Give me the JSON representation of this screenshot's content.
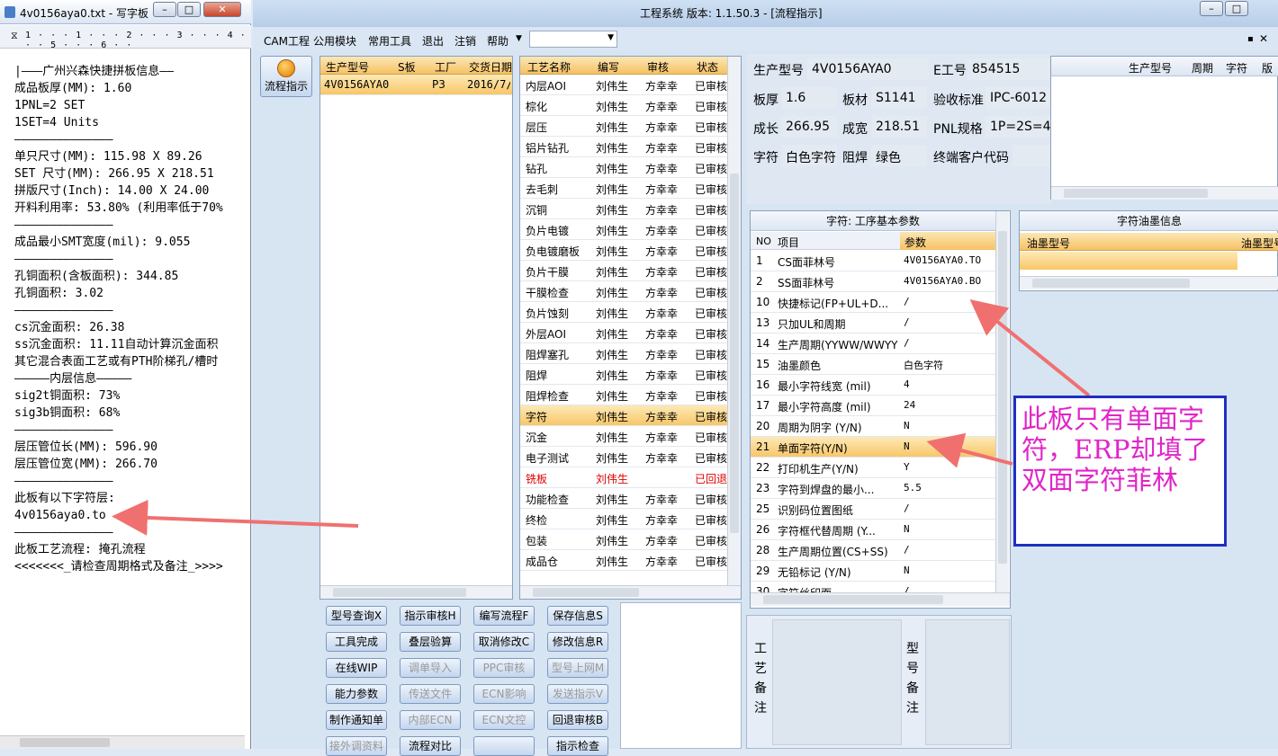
{
  "notepad": {
    "title": "4v0156aya0.txt - 写字板",
    "ruler": "1 · · · 1 · · · 2 · · · 3 · · · 4 · · · 5 · · · 6 · ·",
    "lines": [
      "|———广州兴森快捷拼板信息——",
      "成品板厚(MM): 1.60",
      "1PNL=2 SET",
      "1SET=4 Units",
      "——————————————",
      "单只尺寸(MM): 115.98 X 89.26",
      "SET 尺寸(MM): 266.95 X 218.51",
      "拼版尺寸(Inch): 14.00 X 24.00",
      "开料利用率: 53.80% (利用率低于70%",
      "——————————————",
      "成品最小SMT宽度(mil): 9.055",
      "——————————————",
      "孔铜面积(含板面积): 344.85",
      "孔铜面积: 3.02",
      "——————————————",
      "cs沉金面积: 26.38",
      "ss沉金面积: 11.11自动计算沉金面积",
      "其它混合表面工艺或有PTH阶梯孔/槽时",
      "—————内层信息—————",
      "sig2t铜面积: 73%",
      "sig3b铜面积: 68%",
      "——————————————",
      "层压管位长(MM): 596.90",
      "层压管位宽(MM): 266.70",
      "——————————————",
      "此板有以下字符层:",
      "4v0156aya0.to",
      "——————————————",
      "此板工艺流程: 掩孔流程",
      "<<<<<<<_请检查周期格式及备注_>>>>"
    ]
  },
  "main": {
    "title": "工程系统   版本: 1.1.50.3 - [流程指示]",
    "menu": [
      "CAM工程",
      "公用模块",
      "常用工具",
      "退出",
      "注销",
      "帮助"
    ],
    "side_button": "流程指示",
    "orders": {
      "headers": [
        "生产型号",
        "S板",
        "工厂",
        "交货日期"
      ],
      "rows": [
        [
          "4V0156AYA0",
          "",
          "P3",
          "2016/7/"
        ]
      ]
    },
    "process": {
      "headers": [
        "工艺名称",
        "编写",
        "审核",
        "状态"
      ],
      "rows": [
        [
          "内层AOI",
          "刘伟生",
          "方幸幸",
          "已审核"
        ],
        [
          "棕化",
          "刘伟生",
          "方幸幸",
          "已审核"
        ],
        [
          "层压",
          "刘伟生",
          "方幸幸",
          "已审核"
        ],
        [
          "铝片钻孔",
          "刘伟生",
          "方幸幸",
          "已审核"
        ],
        [
          "钻孔",
          "刘伟生",
          "方幸幸",
          "已审核"
        ],
        [
          "去毛刺",
          "刘伟生",
          "方幸幸",
          "已审核"
        ],
        [
          "沉铜",
          "刘伟生",
          "方幸幸",
          "已审核"
        ],
        [
          "负片电镀",
          "刘伟生",
          "方幸幸",
          "已审核"
        ],
        [
          "负电镀磨板",
          "刘伟生",
          "方幸幸",
          "已审核"
        ],
        [
          "负片干膜",
          "刘伟生",
          "方幸幸",
          "已审核"
        ],
        [
          "干膜检查",
          "刘伟生",
          "方幸幸",
          "已审核"
        ],
        [
          "负片蚀刻",
          "刘伟生",
          "方幸幸",
          "已审核"
        ],
        [
          "外层AOI",
          "刘伟生",
          "方幸幸",
          "已审核"
        ],
        [
          "阻焊塞孔",
          "刘伟生",
          "方幸幸",
          "已审核"
        ],
        [
          "阻焊",
          "刘伟生",
          "方幸幸",
          "已审核"
        ],
        [
          "阻焊检查",
          "刘伟生",
          "方幸幸",
          "已审核"
        ],
        [
          "字符",
          "刘伟生",
          "方幸幸",
          "已审核"
        ],
        [
          "沉金",
          "刘伟生",
          "方幸幸",
          "已审核"
        ],
        [
          "电子测试",
          "刘伟生",
          "方幸幸",
          "已审核"
        ],
        [
          "铣板",
          "刘伟生",
          "",
          "已回退"
        ],
        [
          "功能检查",
          "刘伟生",
          "方幸幸",
          "已审核"
        ],
        [
          "终检",
          "刘伟生",
          "方幸幸",
          "已审核"
        ],
        [
          "包装",
          "刘伟生",
          "方幸幸",
          "已审核"
        ],
        [
          "成品仓",
          "刘伟生",
          "方幸幸",
          "已审核"
        ]
      ]
    },
    "info": {
      "model_label": "生产型号",
      "model": "4V0156AYA0",
      "e_label": "E工号",
      "e_no": "854515",
      "thick_label": "板厚",
      "thick": "1.6",
      "mat_label": "板材",
      "mat": "S1141",
      "std_label": "验收标准",
      "std": "IPC-6012",
      "len_label": "成长",
      "len": "266.95",
      "wid_label": "成宽",
      "wid": "218.51",
      "pnl_label": "PNL规格",
      "pnl": "1P=2S=4U",
      "char_label": "字符",
      "char": "白色字符",
      "mask_label": "阻焊",
      "mask": "绿色",
      "cust_label": "终端客户代码",
      "cust": ""
    },
    "right_mini_headers": [
      "生产型号",
      "周期",
      "字符",
      "版"
    ],
    "params": {
      "title": "字符: 工序基本参数",
      "headers": [
        "NO",
        "项目",
        "参数"
      ],
      "rows": [
        [
          "1",
          "CS面菲林号",
          "4V0156AYA0.TO"
        ],
        [
          "2",
          "SS面菲林号",
          "4V0156AYA0.BO"
        ],
        [
          "10",
          "快捷标记(FP+UL+D...",
          "/"
        ],
        [
          "13",
          "只加UL和周期",
          "/"
        ],
        [
          "14",
          "生产周期(YYWW/WWYY)",
          "/"
        ],
        [
          "15",
          "油墨颜色",
          "白色字符"
        ],
        [
          "16",
          "最小字符线宽 (mil)",
          "4"
        ],
        [
          "17",
          "最小字符高度 (mil)",
          "24"
        ],
        [
          "20",
          "周期为阴字 (Y/N)",
          "N"
        ],
        [
          "21",
          "单面字符(Y/N)",
          "N"
        ],
        [
          "22",
          "打印机生产(Y/N)",
          "Y"
        ],
        [
          "23",
          "字符到焊盘的最小...",
          "5.5"
        ],
        [
          "25",
          "识别码位置图纸",
          "/"
        ],
        [
          "26",
          "字符框代替周期 (Y...",
          "N"
        ],
        [
          "28",
          "生产周期位置(CS+SS)",
          "/"
        ],
        [
          "29",
          "无铅标记 (Y/N)",
          "N"
        ],
        [
          "30",
          "字符丝印面",
          "/"
        ]
      ]
    },
    "ink": {
      "title": "字符油墨信息",
      "headers": [
        "油墨型号",
        "油墨型号"
      ]
    },
    "remark1": "工艺备注",
    "remark2": "型号备注",
    "buttons": [
      [
        "型号查询X",
        "指示审核H",
        "编写流程F",
        "保存信息S"
      ],
      [
        "工具完成",
        "叠层验算",
        "取消修改C",
        "修改信息R"
      ],
      [
        "在线WIP",
        "调单导入",
        "PPC审核",
        "型号上网M"
      ],
      [
        "能力参数",
        "传送文件",
        "ECN影响",
        "发送指示V"
      ],
      [
        "制作通知单",
        "内部ECN",
        "ECN文控",
        "回退审核B"
      ],
      [
        "接外调资料",
        "流程对比",
        "",
        "指示检查"
      ]
    ]
  },
  "annotation": "此板只有单面字符，ERP却填了双面字符菲林",
  "colors": {
    "arrow": "#f07070",
    "note_text": "#e025c8",
    "note_border": "#1f2fc0",
    "selected_row": "#f8c769"
  }
}
